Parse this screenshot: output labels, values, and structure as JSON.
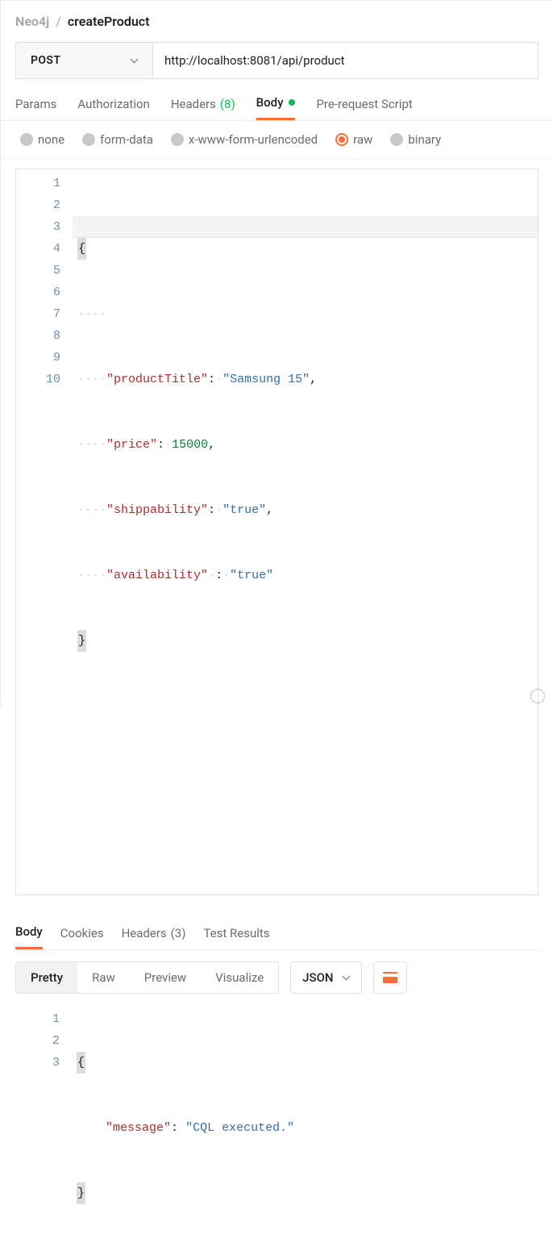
{
  "breadcrumb": {
    "parent": "Neo4j",
    "separator": "/",
    "current": "createProduct"
  },
  "request": {
    "method": "POST",
    "url": "http://localhost:8081/api/product"
  },
  "tabs": {
    "params": "Params",
    "auth": "Authorization",
    "headers_label": "Headers",
    "headers_count": "(8)",
    "body": "Body",
    "prereq": "Pre-request Script"
  },
  "body_types": {
    "none": "none",
    "form": "form-data",
    "urlenc": "x-www-form-urlencoded",
    "raw": "raw",
    "binary": "binary"
  },
  "request_body": {
    "lines": [
      "1",
      "2",
      "3",
      "4",
      "5",
      "6",
      "7",
      "8",
      "9",
      "10"
    ],
    "productTitle_key": "\"productTitle\"",
    "productTitle_val": "\"Samsung 15\"",
    "price_key": "\"price\"",
    "price_val": "15000",
    "shippability_key": "\"shippability\"",
    "shippability_val": "\"true\"",
    "availability_key": "\"availability\"",
    "availability_val": "\"true\""
  },
  "response_tabs": {
    "body": "Body",
    "cookies": "Cookies",
    "headers_label": "Headers",
    "headers_count": "(3)",
    "tests": "Test Results"
  },
  "response_toolbar": {
    "pretty": "Pretty",
    "raw": "Raw",
    "preview": "Preview",
    "visualize": "Visualize",
    "lang": "JSON"
  },
  "response_body": {
    "lines": [
      "1",
      "2",
      "3"
    ],
    "message_key": "\"message\"",
    "message_val": "\"CQL executed.\""
  }
}
